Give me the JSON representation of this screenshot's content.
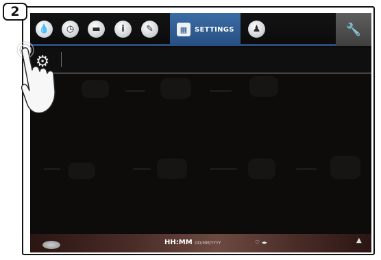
{
  "step": {
    "number": "2"
  },
  "topbar": {
    "icons": [
      {
        "name": "water-drop-icon",
        "glyph": "💧"
      },
      {
        "name": "clock-icon",
        "glyph": "◷"
      },
      {
        "name": "folder-icon",
        "glyph": "▬"
      },
      {
        "name": "info-icon",
        "glyph": "i"
      },
      {
        "name": "pencil-icon",
        "glyph": "✎"
      }
    ],
    "settings_tab": {
      "label": "SETTINGS",
      "icon": "calendar-icon",
      "active": true
    },
    "chef_icon": "chef-icon",
    "tool_icon": "wrench-icon",
    "accent_color": "#2c4d7c"
  },
  "subbar": {
    "icon": "gear-icon"
  },
  "bottombar": {
    "time": "HH:MM",
    "date": "DD/MM/YYYY",
    "status": "♡ ◂▸"
  },
  "overlay": {
    "icon": "pointing-hand-icon"
  }
}
